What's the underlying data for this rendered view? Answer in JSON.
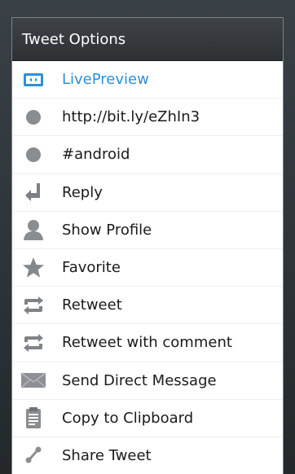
{
  "dialog": {
    "title": "Tweet Options"
  },
  "menu": {
    "items": [
      {
        "label": "LivePreview",
        "icon": "live-preview-icon",
        "accent": true
      },
      {
        "label": "http://bit.ly/eZhIn3",
        "icon": "link-dot-icon"
      },
      {
        "label": "#android",
        "icon": "hashtag-dot-icon"
      },
      {
        "label": "Reply",
        "icon": "reply-icon"
      },
      {
        "label": "Show Profile",
        "icon": "profile-icon"
      },
      {
        "label": "Favorite",
        "icon": "star-icon"
      },
      {
        "label": "Retweet",
        "icon": "retweet-icon"
      },
      {
        "label": "Retweet with comment",
        "icon": "retweet-comment-icon"
      },
      {
        "label": "Send Direct Message",
        "icon": "envelope-icon"
      },
      {
        "label": "Copy to Clipboard",
        "icon": "clipboard-icon"
      },
      {
        "label": "Share Tweet",
        "icon": "share-icon"
      }
    ]
  },
  "colors": {
    "accent": "#2d90d6",
    "header_bg": "#33373a",
    "icon_gray": "#8a8d90"
  }
}
